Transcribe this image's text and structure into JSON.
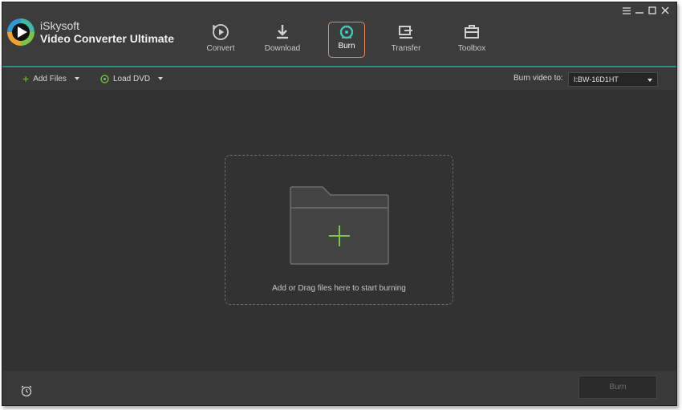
{
  "app": {
    "brand_name": "iSkysoft",
    "product_name": "Video Converter Ultimate"
  },
  "nav": {
    "items": [
      {
        "label": "Convert",
        "icon": "convert-icon"
      },
      {
        "label": "Download",
        "icon": "download-icon"
      },
      {
        "label": "Burn",
        "icon": "burn-icon",
        "active": true
      },
      {
        "label": "Transfer",
        "icon": "transfer-icon"
      },
      {
        "label": "Toolbox",
        "icon": "toolbox-icon"
      }
    ]
  },
  "window_controls": {
    "menu": "☰",
    "minimize": "—",
    "maximize": "☐",
    "close": "✕"
  },
  "toolbar": {
    "add_files_label": "Add Files",
    "load_dvd_label": "Load DVD",
    "burn_to_label": "Burn video to:",
    "burn_target_value": "I:BW-16D1HT"
  },
  "dropzone": {
    "text": "Add or Drag files here to start burning"
  },
  "footer": {
    "burn_button_label": "Burn"
  },
  "colors": {
    "accent": "#2b8f82",
    "active_border": "#e48a5a",
    "plus_green": "#7ec24a",
    "background": "#333232"
  }
}
